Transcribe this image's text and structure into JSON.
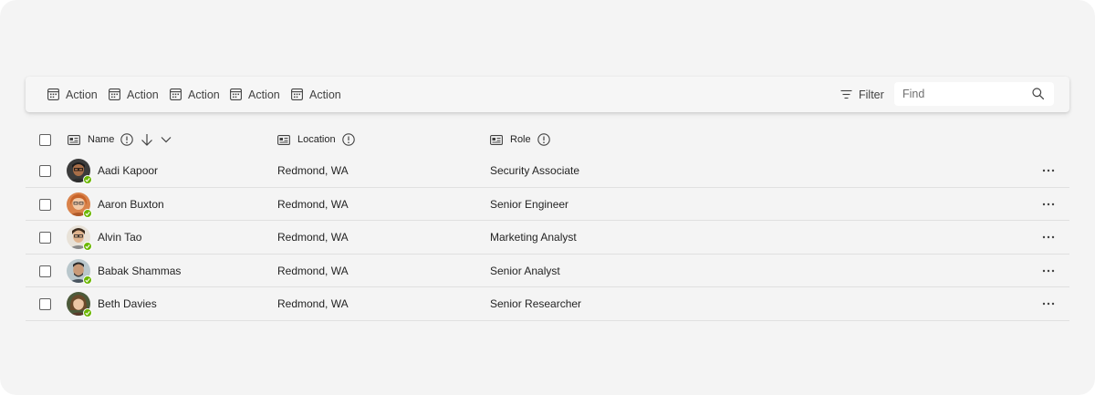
{
  "toolbar": {
    "actions": [
      "Action",
      "Action",
      "Action",
      "Action",
      "Action"
    ],
    "filter_label": "Filter",
    "find_placeholder": "Find"
  },
  "table": {
    "columns": {
      "name": "Name",
      "location": "Location",
      "role": "Role"
    },
    "sort": "descending",
    "rows": [
      {
        "name": "Aadi Kapoor",
        "location": "Redmond, WA",
        "role": "Security Associate",
        "status": "available"
      },
      {
        "name": "Aaron Buxton",
        "location": "Redmond, WA",
        "role": "Senior Engineer",
        "status": "available"
      },
      {
        "name": "Alvin Tao",
        "location": "Redmond, WA",
        "role": "Marketing Analyst",
        "status": "available"
      },
      {
        "name": "Babak Shammas",
        "location": "Redmond, WA",
        "role": "Senior Analyst",
        "status": "available"
      },
      {
        "name": "Beth Davies",
        "location": "Redmond, WA",
        "role": "Senior Researcher",
        "status": "available"
      }
    ]
  },
  "colors": {
    "background": "#f4f4f4",
    "presence_available": "#6bb700",
    "divider": "#e0e0e0"
  }
}
